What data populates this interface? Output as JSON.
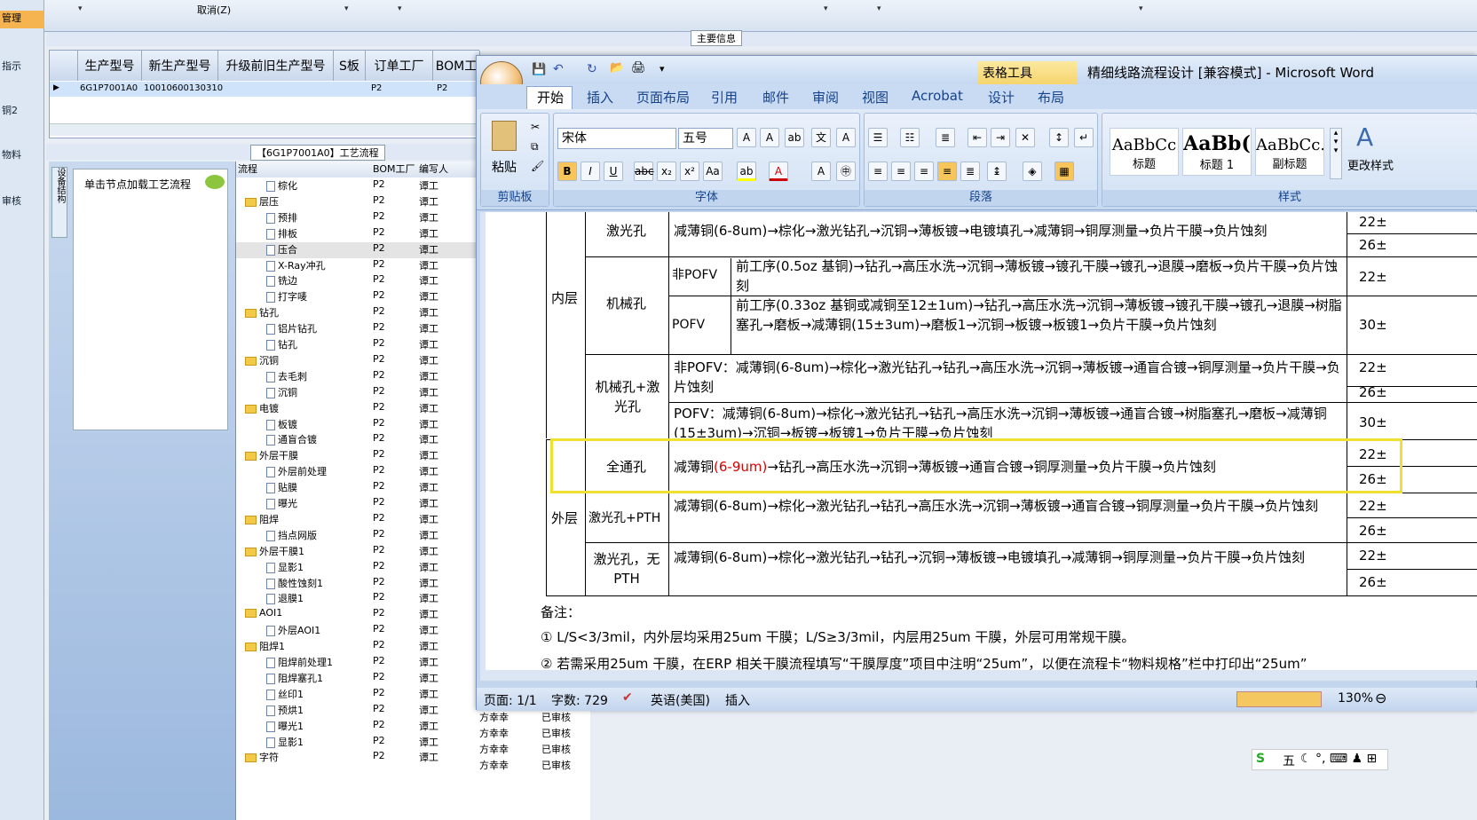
{
  "erp": {
    "nav": [
      "管理",
      "指示",
      "铜2",
      "物料",
      "审核"
    ],
    "toolbar_cancel": "取消(Z)",
    "group_title": "主要信息",
    "grid_headers": [
      "生产型号",
      "新生产型号",
      "升级前旧生产型号",
      "S板",
      "订单工厂",
      "BOM工"
    ],
    "grid_row": [
      "6G1P7001A0",
      "10010600130310",
      "",
      "",
      "P2",
      "P2"
    ],
    "process_title": "【6G1P7001A0】工艺流程",
    "node_hint": "单击节点加载工艺流程",
    "side_tab": "设备结构",
    "tree_headers": [
      "流程",
      "BOM工厂",
      "编写人"
    ],
    "tree": [
      {
        "lvl": 1,
        "t": "棕化",
        "f": "P2",
        "w": "谭工"
      },
      {
        "lvl": 0,
        "t": "层压",
        "f": "P2",
        "w": "谭工"
      },
      {
        "lvl": 1,
        "t": "预排",
        "f": "P2",
        "w": "谭工"
      },
      {
        "lvl": 1,
        "t": "排板",
        "f": "P2",
        "w": "谭工"
      },
      {
        "lvl": 1,
        "t": "压合",
        "f": "P2",
        "w": "谭工"
      },
      {
        "lvl": 1,
        "t": "X-Ray冲孔",
        "f": "P2",
        "w": "谭工"
      },
      {
        "lvl": 1,
        "t": "铣边",
        "f": "P2",
        "w": "谭工"
      },
      {
        "lvl": 1,
        "t": "打字唛",
        "f": "P2",
        "w": "谭工"
      },
      {
        "lvl": 0,
        "t": "钻孔",
        "f": "P2",
        "w": "谭工"
      },
      {
        "lvl": 1,
        "t": "铝片钻孔",
        "f": "P2",
        "w": "谭工"
      },
      {
        "lvl": 1,
        "t": "钻孔",
        "f": "P2",
        "w": "谭工"
      },
      {
        "lvl": 0,
        "t": "沉铜",
        "f": "P2",
        "w": "谭工"
      },
      {
        "lvl": 1,
        "t": "去毛刺",
        "f": "P2",
        "w": "谭工"
      },
      {
        "lvl": 1,
        "t": "沉铜",
        "f": "P2",
        "w": "谭工"
      },
      {
        "lvl": 0,
        "t": "电镀",
        "f": "P2",
        "w": "谭工"
      },
      {
        "lvl": 1,
        "t": "板镀",
        "f": "P2",
        "w": "谭工"
      },
      {
        "lvl": 1,
        "t": "通盲合镀",
        "f": "P2",
        "w": "谭工"
      },
      {
        "lvl": 0,
        "t": "外层干膜",
        "f": "P2",
        "w": "谭工"
      },
      {
        "lvl": 1,
        "t": "外层前处理",
        "f": "P2",
        "w": "谭工"
      },
      {
        "lvl": 1,
        "t": "贴膜",
        "f": "P2",
        "w": "谭工"
      },
      {
        "lvl": 1,
        "t": "曝光",
        "f": "P2",
        "w": "谭工"
      },
      {
        "lvl": 0,
        "t": "阻焊",
        "f": "P2",
        "w": "谭工"
      },
      {
        "lvl": 1,
        "t": "挡点网版",
        "f": "P2",
        "w": "谭工"
      },
      {
        "lvl": 0,
        "t": "外层干膜1",
        "f": "P2",
        "w": "谭工"
      },
      {
        "lvl": 1,
        "t": "显影1",
        "f": "P2",
        "w": "谭工"
      },
      {
        "lvl": 1,
        "t": "酸性蚀刻1",
        "f": "P2",
        "w": "谭工"
      },
      {
        "lvl": 1,
        "t": "退膜1",
        "f": "P2",
        "w": "谭工"
      },
      {
        "lvl": 0,
        "t": "AOI1",
        "f": "P2",
        "w": "谭工"
      },
      {
        "lvl": 1,
        "t": "外层AOI1",
        "f": "P2",
        "w": "谭工"
      },
      {
        "lvl": 0,
        "t": "阻焊1",
        "f": "P2",
        "w": "谭工"
      },
      {
        "lvl": 1,
        "t": "阻焊前处理1",
        "f": "P2",
        "w": "谭工"
      },
      {
        "lvl": 1,
        "t": "阻焊塞孔1",
        "f": "P2",
        "w": "谭工"
      },
      {
        "lvl": 1,
        "t": "丝印1",
        "f": "P2",
        "w": "谭工"
      },
      {
        "lvl": 1,
        "t": "预烘1",
        "f": "P2",
        "w": "谭工"
      },
      {
        "lvl": 1,
        "t": "曝光1",
        "f": "P2",
        "w": "谭工"
      },
      {
        "lvl": 1,
        "t": "显影1",
        "f": "P2",
        "w": "谭工"
      },
      {
        "lvl": 0,
        "t": "字符",
        "f": "P2",
        "w": "谭工"
      }
    ],
    "extra_rows": [
      [
        "方幸幸",
        "已审核"
      ],
      [
        "方幸幸",
        "已审核"
      ],
      [
        "方幸幸",
        "已审核"
      ],
      [
        "方幸幸",
        "已审核"
      ]
    ]
  },
  "word": {
    "title": "精细线路流程设计 [兼容模式] - Microsoft Word",
    "context_tab": "表格工具",
    "tabs": [
      "开始",
      "插入",
      "页面布局",
      "引用",
      "邮件",
      "审阅",
      "视图",
      "Acrobat",
      "设计",
      "布局"
    ],
    "font": "宋体",
    "size": "五号",
    "groups": [
      "剪贴板",
      "字体",
      "段落",
      "样式"
    ],
    "paste": "粘贴",
    "styles": [
      {
        "sample": "AaBbCc",
        "name": "标题"
      },
      {
        "sample": "AaBb(",
        "name": "标题 1"
      },
      {
        "sample": "AaBbCc.",
        "name": "副标题"
      }
    ],
    "change_styles": "更改样式",
    "table": {
      "inner": "内层",
      "outer": "外层",
      "r_laser": "激光孔",
      "r_mech": "机械孔",
      "r_mechlaser": "机械孔+激光孔",
      "r_through": "全通孔",
      "r_laserpth": "激光孔+PTH",
      "r_lasernopth": "激光孔，无PTH",
      "npofv": "非POFV",
      "pofv": "POFV",
      "laser_flow": "减薄铜(6-8um)→棕化→激光钻孔→沉铜→薄板镀→电镀填孔→减薄铜→铜厚测量→负片干膜→负片蚀刻",
      "mech_npofv": "前工序(0.5oz 基铜)→钻孔→高压水洗→沉铜→薄板镀→镀孔干膜→镀孔→退膜→磨板→负片干膜→负片蚀刻",
      "mech_pofv": "前工序(0.33oz 基铜或减铜至12±1um)→钻孔→高压水洗→沉铜→薄板镀→镀孔干膜→镀孔→退膜→树脂塞孔→磨板→减薄铜(15±3um)→磨板1→沉铜→板镀→板镀1→负片干膜→负片蚀刻",
      "ml_npofv": "非POFV：减薄铜(6-8um)→棕化→激光钻孔→钻孔→高压水洗→沉铜→薄板镀→通盲合镀→铜厚测量→负片干膜→负片蚀刻",
      "ml_pofv": "POFV：减薄铜(6-8um)→棕化→激光钻孔→钻孔→高压水洗→沉铜→薄板镀→通盲合镀→树脂塞孔→磨板→减薄铜(15±3um)→沉铜→板镀→板镀1→负片干膜→负片蚀刻",
      "through_pre": "减薄铜",
      "through_red": "(6-9um)",
      "through_post": "→钻孔→高压水洗→沉铜→薄板镀→通盲合镀→铜厚测量→负片干膜→负片蚀刻",
      "lpth_flow": "减薄铜(6-8um)→棕化→激光钻孔→钻孔→高压水洗→沉铜→薄板镀→通盲合镀→铜厚测量→负片干膜→负片蚀刻",
      "lnopth_flow": "减薄铜(6-8um)→棕化→激光钻孔→钻孔→沉铜→薄板镀→电镀填孔→减薄铜→铜厚测量→负片干膜→负片蚀刻",
      "v22": "22±",
      "v26": "26±",
      "v30": "30±"
    },
    "note_title": "备注：",
    "note1": "① L/S<3/3mil，内外层均采用25um 干膜；L/S≥3/3mil，内层用25um 干膜，外层可用常规干膜。",
    "note2": "② 若需采用25um 干膜，在ERP 相关干膜流程填写“干膜厚度”项目中注明“25um”，以便在流程卡“物料规格”栏中打印出“25um”",
    "status": {
      "page": "页面: 1/1",
      "words": "字数: 729",
      "lang": "英语(美国)",
      "mode": "插入",
      "zoom": "130%"
    }
  },
  "ime": {
    "label": "五"
  }
}
